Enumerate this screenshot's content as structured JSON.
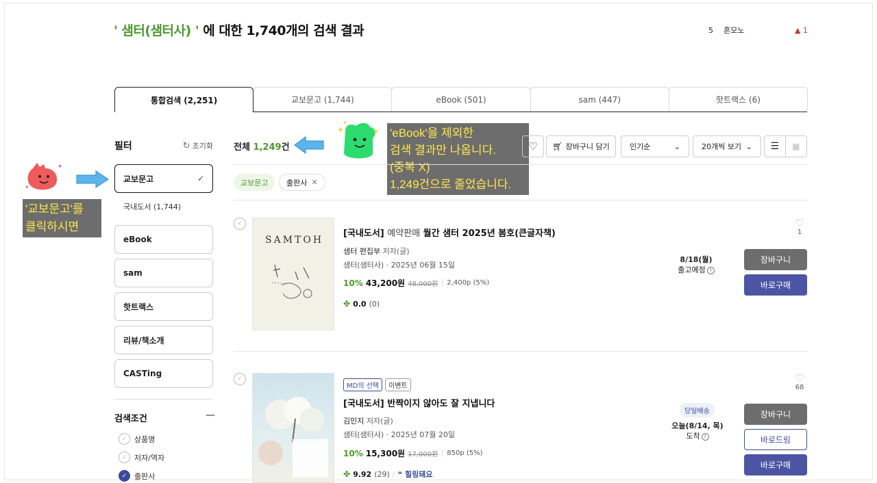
{
  "header": {
    "keyword": "' 샘터(샘터사) '",
    "title_rest": " 에 대한 1,740개의 검색 결과",
    "rank": {
      "num": "5",
      "word": "혼모노",
      "delta": "▲ 1"
    }
  },
  "tabs": [
    {
      "label": "통합검색 (2,251)"
    },
    {
      "label": "교보문고 (1,744)"
    },
    {
      "label": "eBook (501)"
    },
    {
      "label": "sam (447)"
    },
    {
      "label": "핫트랙스 (6)"
    }
  ],
  "filter": {
    "title": "필터",
    "reset": "초기화",
    "items": [
      {
        "label": "교보문고"
      },
      {
        "label": "eBook"
      },
      {
        "label": "sam"
      },
      {
        "label": "핫트랙스"
      },
      {
        "label": "리뷰/책소개"
      },
      {
        "label": "CASTing"
      }
    ],
    "sub_item": "국내도서 (1,744)",
    "conditions_title": "검색조건",
    "conditions": [
      {
        "label": "상품명",
        "checked": false
      },
      {
        "label": "저자/역자",
        "checked": false
      },
      {
        "label": "출판사",
        "checked": true
      }
    ]
  },
  "annotations": {
    "left": [
      "'교보문고'를",
      "클릭하시면"
    ],
    "right": [
      "'eBook'을 제외한",
      "검색 결과만 나옵니다.",
      "(중복 X)",
      "1,249건으로 줄었습니다."
    ]
  },
  "results": {
    "total_prefix": "전체 ",
    "total_count": "1,249",
    "total_suffix": "건",
    "cart_add": "장바구니 담기",
    "sort": "인기순",
    "per_page": "20개씩 보기",
    "chips": {
      "category": "교보문고",
      "publisher": "출판사"
    }
  },
  "products": [
    {
      "cover_title": "SAMTOH",
      "badges": [],
      "category": "[국내도서]",
      "prefix": "예약판매",
      "title": "월간 샘터 2025년 봄호(큰글자책)",
      "author": "샘터 편집부",
      "author_role": "저자(글)",
      "publisher": "샘터(샘터사) · 2025년 06월 15일",
      "discount": "10%",
      "price": "43,200원",
      "orig_price": "48,000원",
      "points": "2,400p (5%)",
      "rating": "0.0",
      "review_count": "(0)",
      "review_keyword": "",
      "ship_line1": "8/18(월)",
      "ship_line2": "출고예정",
      "likes": "1",
      "buttons": [
        "장바구니",
        "바로구매"
      ]
    },
    {
      "cover_title": "",
      "badges": [
        "MD의 선택",
        "이벤트"
      ],
      "category": "[국내도서]",
      "prefix": "",
      "title": "반짝이지 않아도 잘 지냅니다",
      "author": "김민지",
      "author_role": "저자(글)",
      "publisher": "샘터(샘터사) · 2025년 07월 20일",
      "discount": "10%",
      "price": "15,300원",
      "orig_price": "17,000원",
      "points": "850p (5%)",
      "rating": "9.92",
      "review_count": "(29)",
      "review_keyword": "힐링돼요",
      "same_day": "당일배송",
      "ship_line1": "오늘(8/14, 목)",
      "ship_line2": "도착",
      "likes": "68",
      "buttons": [
        "장바구니",
        "바로드림",
        "바로구매"
      ]
    }
  ]
}
